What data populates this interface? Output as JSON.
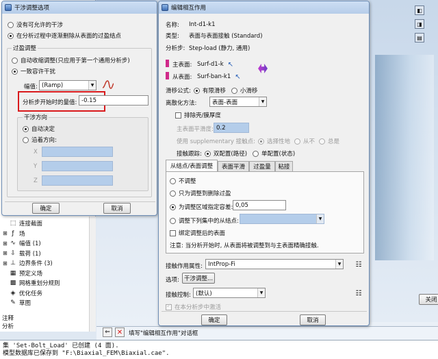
{
  "colors": {
    "highlight_box": "#d9191c",
    "field_blue": "#b4cdea",
    "ramp_icon": "#c0392b"
  },
  "background": {
    "tree": {
      "items": [
        {
          "label": "连接截面",
          "expand": "",
          "icon": "section-icon"
        },
        {
          "label": "场",
          "expand": "⊞",
          "icon": "field-icon"
        },
        {
          "label": "幅值 (1)",
          "expand": "⊞",
          "icon": "amplitude-icon"
        },
        {
          "label": "载荷 (1)",
          "expand": "⊞",
          "icon": "load-icon"
        },
        {
          "label": "边界条件 (3)",
          "expand": "⊞",
          "icon": "bc-icon"
        },
        {
          "label": "预定义场",
          "expand": "",
          "icon": "predefined-icon"
        },
        {
          "label": "网格重划分规则",
          "expand": "",
          "icon": "remesh-icon"
        },
        {
          "label": "优化任务",
          "expand": "",
          "icon": "optimization-icon"
        },
        {
          "label": "草图",
          "expand": "",
          "icon": "sketch-icon"
        }
      ],
      "bottom_items": [
        "注释",
        "分析"
      ]
    },
    "prompt_text": "填写\"编辑相互作用\"对话框",
    "message_lines": [
      "集 'Set-Bolt_Load' 已创建 (4 面).",
      "模型数据库已保存到 \"F:\\Biaxial_FEM\\Biaxial.cae\"."
    ],
    "right_button": "关闭"
  },
  "interference_dialog": {
    "title": "干涉调整选项",
    "option_no_interference": "没有可允许的干涉",
    "option_remove_gradually": "在分析过程中逐渐删除从表面的过盈结点",
    "group_title": "过盈调整",
    "option_auto": "自动收缩调整(只应用于第一个通用分析步)",
    "option_uniform": "一致容许干扰",
    "amplitude_label": "幅值:",
    "amplitude_value": "(Ramp)",
    "start_label": "分析步开始时的量值:",
    "start_value": "-0.15",
    "direction_group": "干涉方向",
    "direction_auto": "自动决定",
    "direction_along": "沿着方向:",
    "x_label": "X",
    "y_label": "Y",
    "z_label": "Z",
    "ok": "确定",
    "cancel": "取消"
  },
  "edit_dialog": {
    "title": "编辑相互作用",
    "name_label": "名称:",
    "name_value": "Int-d1-k1",
    "type_label": "类型:",
    "type_value": "表面与表面接触 (Standard)",
    "step_label": "分析步:",
    "step_value": "Step-load (静力, 通用)",
    "master_label": "主表面:",
    "master_value": "Surf-d1-k",
    "slave_label": "从表面:",
    "slave_value": "Surf-ban-k1",
    "sliding_label": "滑移公式:",
    "sliding_finite": "有限滑移",
    "sliding_small": "小滑移",
    "discretization_label": "离散化方法:",
    "discretization_value": "表面-表面",
    "exclude_shell": "排除壳/膜厚度",
    "smoothing_label": "主表面平滑度:",
    "smoothing_value": "0.2",
    "supplementary_label": "使用 supplementary 接触点:",
    "supp_selective": "选择性地",
    "supp_never": "从不",
    "supp_always": "总是",
    "tracking_label": "接触跟踪:",
    "tracking_two": "双配置(路径)",
    "tracking_single": "单配置(状态)",
    "tabs": [
      "从结点/表面调整",
      "表面平滑",
      "过盈量",
      "粘接"
    ],
    "adjust_none": "不调整",
    "adjust_overclosure": "只为调整到删除过盈",
    "adjust_tolerance": "为调整区域指定容差:",
    "adjust_tolerance_value": "0,05",
    "adjust_set": "调整下列集中的从结点:",
    "tie_surfaces": "绑定调整后的表面",
    "note": "注意: 当分析开始时, 从表面将被调整到与主表面精确接触.",
    "property_label": "接触作用属性:",
    "property_value": "IntProp-Fi",
    "options_label": "选项:",
    "options_button": "干涉调整...",
    "control_label": "接触控制:",
    "control_value": "(默认)",
    "activate_label": "在本分析步中激活",
    "ok": "确定",
    "cancel": "取消"
  }
}
